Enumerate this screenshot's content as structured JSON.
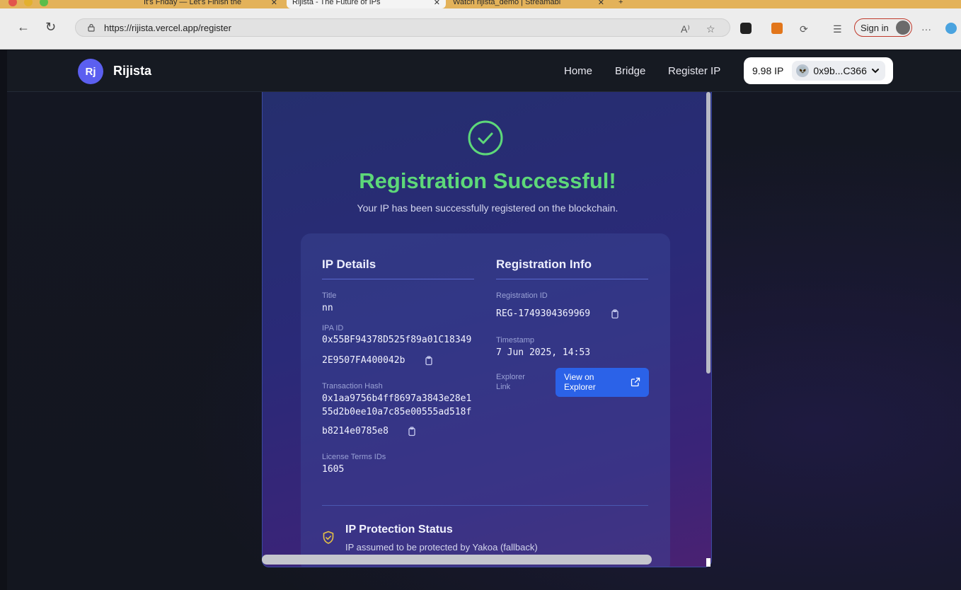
{
  "browser": {
    "tabs": [
      {
        "label": "It's Friday — Let's Finish the"
      },
      {
        "label": "Rijista - The Future of IPs"
      },
      {
        "label": "Watch rijista_demo | Streamabl"
      }
    ],
    "url": "https://rijista.vercel.app/register",
    "sign_in_label": "Sign in",
    "more_label": "···"
  },
  "nav": {
    "logo": "Rj",
    "brand": "Rijista",
    "links": [
      "Home",
      "Bridge",
      "Register IP"
    ],
    "balance": "9.98 IP",
    "address": "0x9b...C366"
  },
  "success": {
    "title": "Registration Successful!",
    "subtitle": "Your IP has been successfully registered on the blockchain."
  },
  "ip_details": {
    "heading": "IP Details",
    "title_label": "Title",
    "title_value": "nn",
    "ipa_label": "IPA ID",
    "ipa_line1": "0x55BF94378D525f89a01C18349",
    "ipa_line2": "2E9507FA400042b",
    "tx_label": "Transaction Hash",
    "tx_line1": "0x1aa9756b4ff8697a3843e28e1",
    "tx_line2": "55d2b0ee10a7c85e00555ad518f",
    "tx_line3": "b8214e0785e8",
    "license_label": "License Terms IDs",
    "license_value": "1605"
  },
  "registration_info": {
    "heading": "Registration Info",
    "id_label": "Registration ID",
    "id_value": "REG-1749304369969",
    "timestamp_label": "Timestamp",
    "timestamp_value": "7 Jun 2025, 14:53",
    "explorer_label_1": "Explorer",
    "explorer_label_2": "Link",
    "explorer_btn_1": "View on",
    "explorer_btn_2": "Explorer"
  },
  "protection": {
    "title": "IP Protection Status",
    "text": "IP assumed to be protected by Yakoa (fallback)"
  },
  "colors": {
    "success_green": "#5dd879",
    "button_blue": "#2b62e8",
    "logo_purple": "#5b5ff0"
  }
}
